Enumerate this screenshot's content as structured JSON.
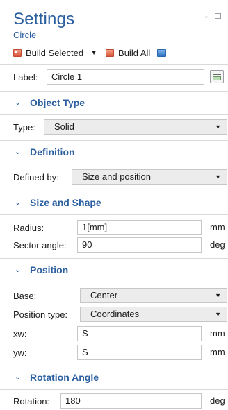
{
  "header": {
    "title": "Settings",
    "subtitle": "Circle"
  },
  "window_controls": {
    "collapse_icon": "chevron-down-icon",
    "restore_icon": "restore-icon"
  },
  "toolbar": {
    "build_selected": "Build Selected",
    "build_all": "Build All"
  },
  "label_row": {
    "label": "Label:",
    "value": "Circle 1"
  },
  "object_type": {
    "title": "Object Type",
    "type_label": "Type:",
    "type_value": "Solid"
  },
  "definition": {
    "title": "Definition",
    "defined_by_label": "Defined by:",
    "defined_by_value": "Size and position"
  },
  "size_shape": {
    "title": "Size and Shape",
    "radius_label": "Radius:",
    "radius_value": "1[mm]",
    "radius_unit": "mm",
    "sector_label": "Sector angle:",
    "sector_value": "90",
    "sector_unit": "deg"
  },
  "position": {
    "title": "Position",
    "base_label": "Base:",
    "base_value": "Center",
    "ptype_label": "Position type:",
    "ptype_value": "Coordinates",
    "xw_label": "xw:",
    "xw_value": "S",
    "xw_unit": "mm",
    "yw_label": "yw:",
    "yw_value": "S",
    "yw_unit": "mm"
  },
  "rotation": {
    "title": "Rotation Angle",
    "rotation_label": "Rotation:",
    "rotation_value": "180",
    "rotation_unit": "deg"
  },
  "colors": {
    "accent": "#2b5fa0",
    "border": "#c7c7c7",
    "divider": "#d9d9d9"
  }
}
